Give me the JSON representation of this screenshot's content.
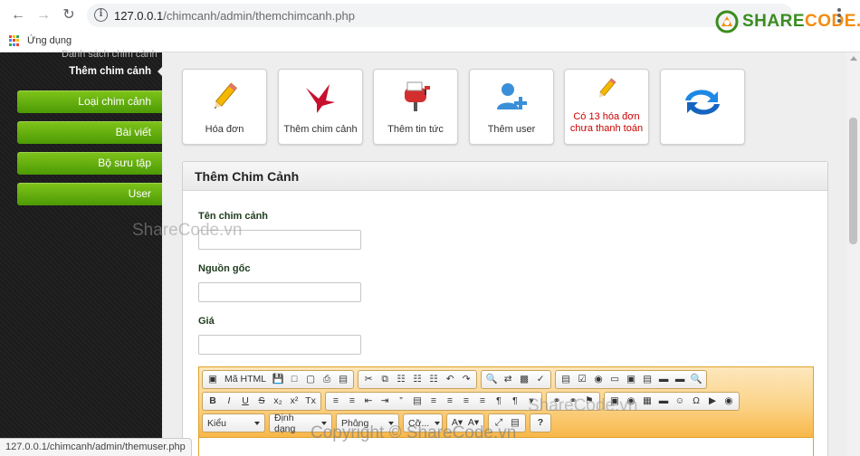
{
  "browser": {
    "url_host": "127.0.0.1",
    "url_path": "/chimcanh/admin/themchimcanh.php",
    "bookmarks": [
      {
        "label": "Ứng dụng",
        "icon": "apps-grid-icon"
      }
    ]
  },
  "logo": {
    "part1": "SHARE",
    "part2": "CODE.vn",
    "colors": {
      "green": "#3a8c1f",
      "orange": "#f28c0f"
    }
  },
  "sidebar": {
    "cut_text": "Danh sách chim cảnh",
    "active_item": "Thêm chim cảnh",
    "items": [
      {
        "label": "Loại chim cảnh"
      },
      {
        "label": "Bài viết"
      },
      {
        "label": "Bộ sưu tập"
      },
      {
        "label": "User"
      }
    ],
    "button_color": "#5aa80c"
  },
  "tiles": [
    {
      "label": "Hóa đơn",
      "icon": "pencil-icon"
    },
    {
      "label": "Thêm chim cảnh",
      "icon": "bird-icon"
    },
    {
      "label": "Thêm tin tức",
      "icon": "mailbox-icon"
    },
    {
      "label": "Thêm user",
      "icon": "add-user-icon"
    },
    {
      "label": "Có 13 hóa đơn chưa thanh toán",
      "icon": "pencil-icon",
      "alert": true
    },
    {
      "label": "",
      "icon": "refresh-arrows-icon"
    }
  ],
  "panel": {
    "title": "Thêm Chim Cảnh",
    "fields": [
      {
        "label": "Tên chim cảnh",
        "value": ""
      },
      {
        "label": "Nguồn gốc",
        "value": ""
      },
      {
        "label": "Giá",
        "value": ""
      }
    ]
  },
  "editor": {
    "source_label": "Mã HTML",
    "formatting_labels": [
      "B",
      "I",
      "U",
      "S",
      "x₂",
      "x²",
      "Tx"
    ],
    "combos": [
      "Kiểu",
      "Định dạng",
      "Phông",
      "Cỡ..."
    ],
    "help_label": "?"
  },
  "status_bar": {
    "url": "127.0.0.1/chimcanh/admin/themuser.php"
  },
  "watermarks": {
    "main": "ShareCode.vn",
    "copyright": "Copyright © ShareCode.vn"
  }
}
